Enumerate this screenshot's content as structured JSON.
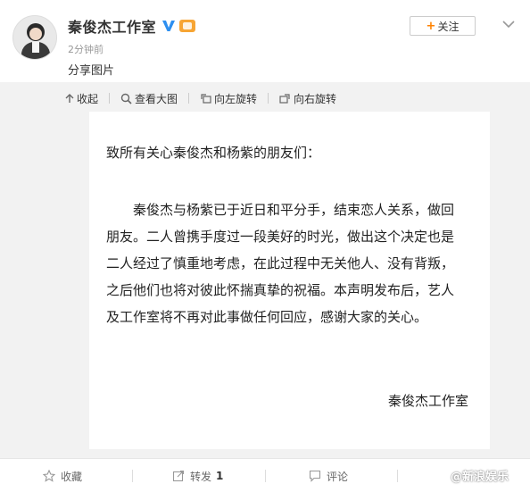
{
  "header": {
    "name": "秦俊杰工作室",
    "time": "2分钟前",
    "description": "分享图片",
    "follow_label": "关注",
    "verified_icon": "verified-v-icon",
    "vip_icon": "vip-badge-icon"
  },
  "viewer": {
    "tools": [
      {
        "label": "收起",
        "icon": "collapse-icon"
      },
      {
        "label": "查看大图",
        "icon": "zoom-icon"
      },
      {
        "label": "向左旋转",
        "icon": "rotate-left-icon"
      },
      {
        "label": "向右旋转",
        "icon": "rotate-right-icon"
      }
    ],
    "image": {
      "greeting": "致所有关心秦俊杰和杨紫的朋友们：",
      "lines": [
        "秦俊杰与杨紫已于近日和平分手，结束恋人关系，做回",
        "朋友。二人曾携手度过一段美好的时光，做出这个决定也是",
        "二人经过了慎重地考虑，在此过程中无关他人、没有背叛，",
        "之后他们也将对彼此怀揣真挚的祝福。本声明发布后，艺人",
        "及工作室将不再对此事做任何回应，感谢大家的关心。"
      ],
      "signature": "秦俊杰工作室"
    }
  },
  "footer": {
    "favorite_label": "收藏",
    "repost_label": "转发",
    "repost_count": "1",
    "comment_label": "评论",
    "watermark": "@新浪娱乐"
  },
  "colors": {
    "accent_orange": "#ff8200",
    "verified_blue": "#2d8ff0",
    "vip_gold": "#f7a534",
    "viewer_bg": "#f2f2f2"
  }
}
